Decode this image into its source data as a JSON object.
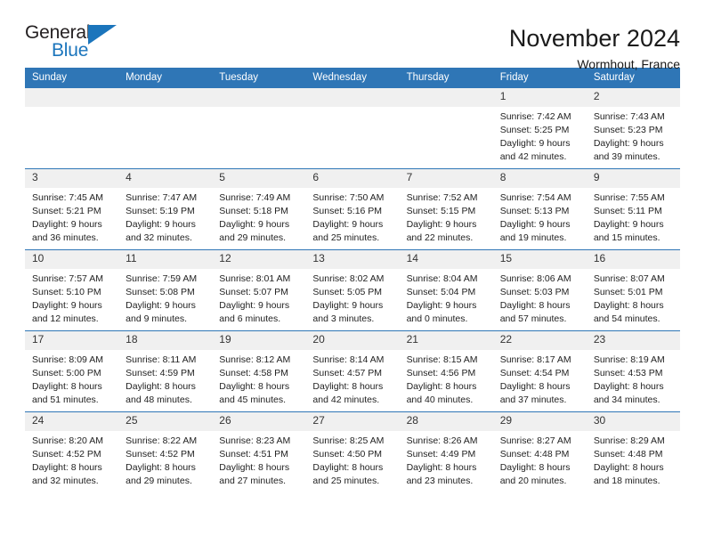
{
  "brand": {
    "name_part1": "General",
    "name_part2": "Blue",
    "logo_icon": "triangle-icon",
    "color_dark": "#231f20",
    "color_blue": "#1b75bc"
  },
  "header": {
    "title": "November 2024",
    "subtitle": "Wormhout, France"
  },
  "theme": {
    "header_blue": "#2f76b6",
    "daynum_bg": "#f0f0f0",
    "text": "#222222"
  },
  "calendar": {
    "weekday_headers": [
      "Sunday",
      "Monday",
      "Tuesday",
      "Wednesday",
      "Thursday",
      "Friday",
      "Saturday"
    ],
    "weeks": [
      [
        {
          "day": "",
          "sunrise": "",
          "sunset": "",
          "daylight_line1": "",
          "daylight_line2": ""
        },
        {
          "day": "",
          "sunrise": "",
          "sunset": "",
          "daylight_line1": "",
          "daylight_line2": ""
        },
        {
          "day": "",
          "sunrise": "",
          "sunset": "",
          "daylight_line1": "",
          "daylight_line2": ""
        },
        {
          "day": "",
          "sunrise": "",
          "sunset": "",
          "daylight_line1": "",
          "daylight_line2": ""
        },
        {
          "day": "",
          "sunrise": "",
          "sunset": "",
          "daylight_line1": "",
          "daylight_line2": ""
        },
        {
          "day": "1",
          "sunrise": "Sunrise: 7:42 AM",
          "sunset": "Sunset: 5:25 PM",
          "daylight_line1": "Daylight: 9 hours",
          "daylight_line2": "and 42 minutes."
        },
        {
          "day": "2",
          "sunrise": "Sunrise: 7:43 AM",
          "sunset": "Sunset: 5:23 PM",
          "daylight_line1": "Daylight: 9 hours",
          "daylight_line2": "and 39 minutes."
        }
      ],
      [
        {
          "day": "3",
          "sunrise": "Sunrise: 7:45 AM",
          "sunset": "Sunset: 5:21 PM",
          "daylight_line1": "Daylight: 9 hours",
          "daylight_line2": "and 36 minutes."
        },
        {
          "day": "4",
          "sunrise": "Sunrise: 7:47 AM",
          "sunset": "Sunset: 5:19 PM",
          "daylight_line1": "Daylight: 9 hours",
          "daylight_line2": "and 32 minutes."
        },
        {
          "day": "5",
          "sunrise": "Sunrise: 7:49 AM",
          "sunset": "Sunset: 5:18 PM",
          "daylight_line1": "Daylight: 9 hours",
          "daylight_line2": "and 29 minutes."
        },
        {
          "day": "6",
          "sunrise": "Sunrise: 7:50 AM",
          "sunset": "Sunset: 5:16 PM",
          "daylight_line1": "Daylight: 9 hours",
          "daylight_line2": "and 25 minutes."
        },
        {
          "day": "7",
          "sunrise": "Sunrise: 7:52 AM",
          "sunset": "Sunset: 5:15 PM",
          "daylight_line1": "Daylight: 9 hours",
          "daylight_line2": "and 22 minutes."
        },
        {
          "day": "8",
          "sunrise": "Sunrise: 7:54 AM",
          "sunset": "Sunset: 5:13 PM",
          "daylight_line1": "Daylight: 9 hours",
          "daylight_line2": "and 19 minutes."
        },
        {
          "day": "9",
          "sunrise": "Sunrise: 7:55 AM",
          "sunset": "Sunset: 5:11 PM",
          "daylight_line1": "Daylight: 9 hours",
          "daylight_line2": "and 15 minutes."
        }
      ],
      [
        {
          "day": "10",
          "sunrise": "Sunrise: 7:57 AM",
          "sunset": "Sunset: 5:10 PM",
          "daylight_line1": "Daylight: 9 hours",
          "daylight_line2": "and 12 minutes."
        },
        {
          "day": "11",
          "sunrise": "Sunrise: 7:59 AM",
          "sunset": "Sunset: 5:08 PM",
          "daylight_line1": "Daylight: 9 hours",
          "daylight_line2": "and 9 minutes."
        },
        {
          "day": "12",
          "sunrise": "Sunrise: 8:01 AM",
          "sunset": "Sunset: 5:07 PM",
          "daylight_line1": "Daylight: 9 hours",
          "daylight_line2": "and 6 minutes."
        },
        {
          "day": "13",
          "sunrise": "Sunrise: 8:02 AM",
          "sunset": "Sunset: 5:05 PM",
          "daylight_line1": "Daylight: 9 hours",
          "daylight_line2": "and 3 minutes."
        },
        {
          "day": "14",
          "sunrise": "Sunrise: 8:04 AM",
          "sunset": "Sunset: 5:04 PM",
          "daylight_line1": "Daylight: 9 hours",
          "daylight_line2": "and 0 minutes."
        },
        {
          "day": "15",
          "sunrise": "Sunrise: 8:06 AM",
          "sunset": "Sunset: 5:03 PM",
          "daylight_line1": "Daylight: 8 hours",
          "daylight_line2": "and 57 minutes."
        },
        {
          "day": "16",
          "sunrise": "Sunrise: 8:07 AM",
          "sunset": "Sunset: 5:01 PM",
          "daylight_line1": "Daylight: 8 hours",
          "daylight_line2": "and 54 minutes."
        }
      ],
      [
        {
          "day": "17",
          "sunrise": "Sunrise: 8:09 AM",
          "sunset": "Sunset: 5:00 PM",
          "daylight_line1": "Daylight: 8 hours",
          "daylight_line2": "and 51 minutes."
        },
        {
          "day": "18",
          "sunrise": "Sunrise: 8:11 AM",
          "sunset": "Sunset: 4:59 PM",
          "daylight_line1": "Daylight: 8 hours",
          "daylight_line2": "and 48 minutes."
        },
        {
          "day": "19",
          "sunrise": "Sunrise: 8:12 AM",
          "sunset": "Sunset: 4:58 PM",
          "daylight_line1": "Daylight: 8 hours",
          "daylight_line2": "and 45 minutes."
        },
        {
          "day": "20",
          "sunrise": "Sunrise: 8:14 AM",
          "sunset": "Sunset: 4:57 PM",
          "daylight_line1": "Daylight: 8 hours",
          "daylight_line2": "and 42 minutes."
        },
        {
          "day": "21",
          "sunrise": "Sunrise: 8:15 AM",
          "sunset": "Sunset: 4:56 PM",
          "daylight_line1": "Daylight: 8 hours",
          "daylight_line2": "and 40 minutes."
        },
        {
          "day": "22",
          "sunrise": "Sunrise: 8:17 AM",
          "sunset": "Sunset: 4:54 PM",
          "daylight_line1": "Daylight: 8 hours",
          "daylight_line2": "and 37 minutes."
        },
        {
          "day": "23",
          "sunrise": "Sunrise: 8:19 AM",
          "sunset": "Sunset: 4:53 PM",
          "daylight_line1": "Daylight: 8 hours",
          "daylight_line2": "and 34 minutes."
        }
      ],
      [
        {
          "day": "24",
          "sunrise": "Sunrise: 8:20 AM",
          "sunset": "Sunset: 4:52 PM",
          "daylight_line1": "Daylight: 8 hours",
          "daylight_line2": "and 32 minutes."
        },
        {
          "day": "25",
          "sunrise": "Sunrise: 8:22 AM",
          "sunset": "Sunset: 4:52 PM",
          "daylight_line1": "Daylight: 8 hours",
          "daylight_line2": "and 29 minutes."
        },
        {
          "day": "26",
          "sunrise": "Sunrise: 8:23 AM",
          "sunset": "Sunset: 4:51 PM",
          "daylight_line1": "Daylight: 8 hours",
          "daylight_line2": "and 27 minutes."
        },
        {
          "day": "27",
          "sunrise": "Sunrise: 8:25 AM",
          "sunset": "Sunset: 4:50 PM",
          "daylight_line1": "Daylight: 8 hours",
          "daylight_line2": "and 25 minutes."
        },
        {
          "day": "28",
          "sunrise": "Sunrise: 8:26 AM",
          "sunset": "Sunset: 4:49 PM",
          "daylight_line1": "Daylight: 8 hours",
          "daylight_line2": "and 23 minutes."
        },
        {
          "day": "29",
          "sunrise": "Sunrise: 8:27 AM",
          "sunset": "Sunset: 4:48 PM",
          "daylight_line1": "Daylight: 8 hours",
          "daylight_line2": "and 20 minutes."
        },
        {
          "day": "30",
          "sunrise": "Sunrise: 8:29 AM",
          "sunset": "Sunset: 4:48 PM",
          "daylight_line1": "Daylight: 8 hours",
          "daylight_line2": "and 18 minutes."
        }
      ]
    ]
  }
}
